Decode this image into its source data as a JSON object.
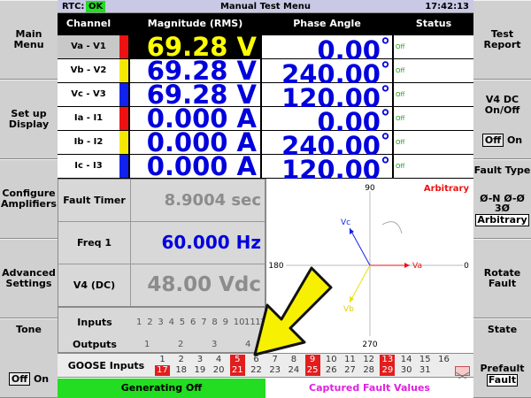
{
  "header": {
    "rtc_label": "RTC:",
    "rtc_status": "OK",
    "title": "Manual Test Menu",
    "time": "17:42:13"
  },
  "left_buttons": [
    {
      "label": "Main\nMenu"
    },
    {
      "label": "Set up\nDisplay"
    },
    {
      "label": "Configure\nAmplifiers"
    },
    {
      "label": "Advanced\nSettings"
    },
    {
      "label_top": "Tone",
      "off": "Off",
      "on": "On"
    }
  ],
  "right_buttons": {
    "test_report": "Test\nReport",
    "v4dc": "V4 DC\nOn/Off",
    "v4dc_off": "Off",
    "v4dc_on": "On",
    "fault_type": "Fault Type",
    "fault_opts": "Ø-N  Ø-Ø",
    "fault_3ph": "3Ø",
    "fault_arbitrary": "Arbitrary",
    "rotate_fault": "Rotate\nFault",
    "state": "State",
    "prefault": "Prefault",
    "fault": "Fault"
  },
  "table": {
    "headers": [
      "Channel",
      "Magnitude (RMS)",
      "Phase Angle",
      "Status"
    ],
    "rows": [
      {
        "channel": "Va - V1",
        "magnitude": "69.28 V",
        "angle": "0.00",
        "status": "Off",
        "color": "#ee1111"
      },
      {
        "channel": "Vb - V2",
        "magnitude": "69.28 V",
        "angle": "240.00",
        "status": "Off",
        "color": "#f5e800"
      },
      {
        "channel": "Vc - V3",
        "magnitude": "69.28 V",
        "angle": "120.00",
        "status": "Off",
        "color": "#1122ee"
      },
      {
        "channel": "Ia - I1",
        "magnitude": "0.000 A",
        "angle": "0.00",
        "status": "Off",
        "color": "#ee1111"
      },
      {
        "channel": "Ib - I2",
        "magnitude": "0.000 A",
        "angle": "240.00",
        "status": "Off",
        "color": "#f5e800"
      },
      {
        "channel": "Ic - I3",
        "magnitude": "0.000 A",
        "angle": "120.00",
        "status": "Off",
        "color": "#1122ee"
      }
    ],
    "degree_symbol": "°"
  },
  "info": {
    "fault_timer_label": "Fault Timer",
    "fault_timer_value": "8.9004 sec",
    "freq_label": "Freq 1",
    "freq_value": "60.000 Hz",
    "v4_label": "V4 (DC)",
    "v4_value": "48.00 Vdc"
  },
  "io": {
    "inputs_label": "Inputs",
    "inputs": [
      "1",
      "2",
      "3",
      "4",
      "5",
      "6",
      "7",
      "8",
      "9",
      "10",
      "11",
      "12"
    ],
    "outputs_label": "Outputs",
    "outputs": [
      "1",
      "2",
      "3",
      "4"
    ]
  },
  "goose": {
    "label": "GOOSE Inputs",
    "top": [
      "1",
      "2",
      "3",
      "4",
      "5",
      "6",
      "7",
      "8",
      "9",
      "10",
      "11",
      "12",
      "13",
      "14",
      "15",
      "16"
    ],
    "bottom": [
      "17",
      "18",
      "19",
      "20",
      "21",
      "22",
      "23",
      "24",
      "25",
      "26",
      "27",
      "28",
      "29",
      "30",
      "31",
      "32"
    ],
    "top_on": [
      "5",
      "9",
      "13"
    ],
    "bottom_on": [
      "17",
      "21",
      "25",
      "29"
    ]
  },
  "phasor": {
    "label_90": "90",
    "label_180": "180",
    "label_0": "0",
    "label_270": "270",
    "mode": "Arbitrary",
    "vector_labels": {
      "va": "Va",
      "vb": "Vb",
      "vc": "Vc"
    },
    "colors": {
      "va": "#ee1111",
      "vb": "#f0e000",
      "vc": "#1122ee",
      "mode": "#ee1111"
    }
  },
  "status_bar": {
    "generating": "Generating Off",
    "captured": "Captured Fault Values"
  }
}
